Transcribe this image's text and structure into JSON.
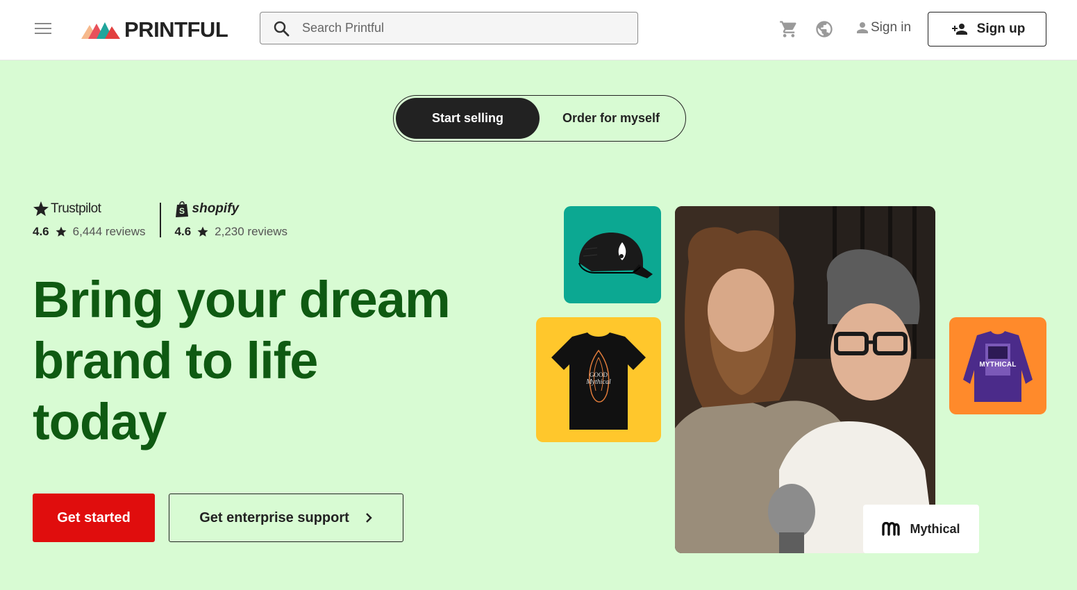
{
  "header": {
    "logo_text": "PRINTFUL",
    "search_placeholder": "Search Printful",
    "signin_label": "Sign in",
    "signup_label": "Sign up"
  },
  "toggle": {
    "active_label": "Start selling",
    "inactive_label": "Order for myself"
  },
  "ratings": [
    {
      "brand": "Trustpilot",
      "score": "4.6",
      "reviews": "6,444 reviews"
    },
    {
      "brand": "shopify",
      "score": "4.6",
      "reviews": "2,230 reviews"
    }
  ],
  "hero": {
    "headline": "Bring your dream brand to life today",
    "primary_cta": "Get started",
    "secondary_cta": "Get enterprise support"
  },
  "products": {
    "hoodie_print": "MYTHICAL",
    "brand_name": "Mythical"
  },
  "colors": {
    "background": "#d8fbd3",
    "headline": "#0f5a12",
    "primary_cta": "#e00d0d",
    "cap_card": "#0ca892",
    "tshirt_card": "#ffc72c",
    "hoodie_card": "#ff8a2b"
  },
  "icons": [
    "menu-icon",
    "search-icon",
    "cart-icon",
    "globe-icon",
    "user-icon",
    "add-user-icon",
    "star-icon",
    "shopify-bag-icon",
    "chevron-right-icon",
    "mythical-logo-icon"
  ]
}
